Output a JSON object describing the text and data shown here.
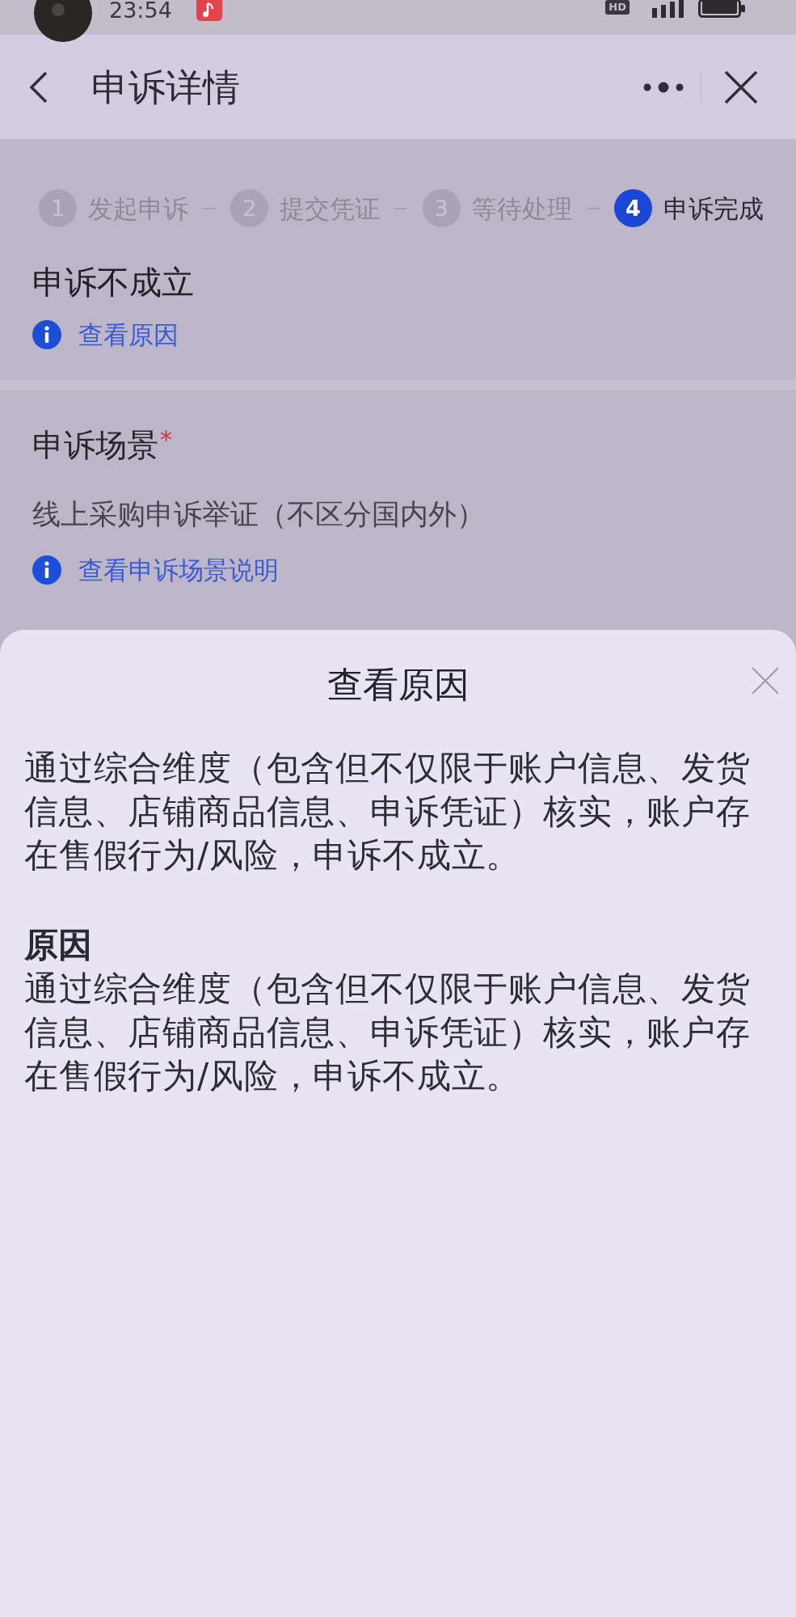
{
  "status_bar": {
    "time": "23:54",
    "network_badge": "HD"
  },
  "nav_bar": {
    "title": "申诉详情"
  },
  "steps": [
    {
      "number": "1",
      "label": "发起申诉",
      "active": false
    },
    {
      "number": "2",
      "label": "提交凭证",
      "active": false
    },
    {
      "number": "3",
      "label": "等待处理",
      "active": false
    },
    {
      "number": "4",
      "label": "申诉完成",
      "active": true
    }
  ],
  "result": {
    "title": "申诉不成立",
    "link": "查看原因"
  },
  "scene": {
    "label": "申诉场景",
    "required_mark": "*",
    "value": "线上采购申诉举证（不区分国内外）",
    "link": "查看申诉场景说明"
  },
  "sheet": {
    "title": "查看原因",
    "blocks": [
      {
        "kind": "paragraph",
        "text": "通过综合维度（包含但不仅限于账户信息、发货信息、店铺商品信息、申诉凭证）核实，账户存在售假行为/风险，申诉不成立。"
      },
      {
        "kind": "heading",
        "text": "原因"
      },
      {
        "kind": "paragraph",
        "text": "通过综合维度（包含但不仅限于账户信息、发货信息、店铺商品信息、申诉凭证）核实，账户存在售假行为/风险，申诉不成立。"
      }
    ]
  }
}
